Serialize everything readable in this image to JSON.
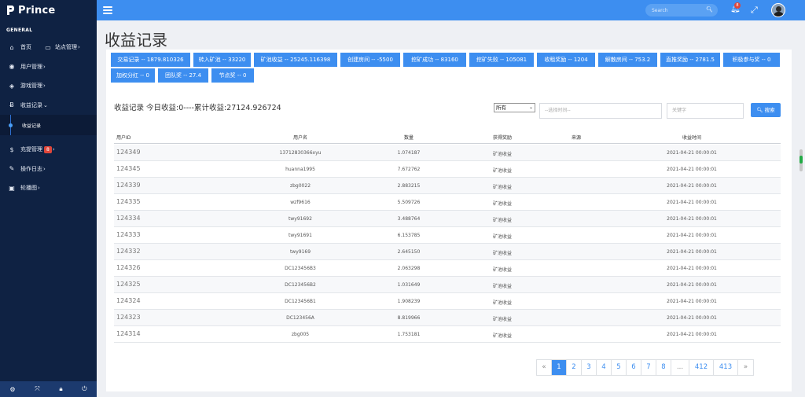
{
  "brand": {
    "name": "Prince"
  },
  "sidebar": {
    "section": "GENERAL",
    "items": [
      {
        "icon": "home-icon",
        "label": "首页",
        "extra_icon": "monitor-icon",
        "extra_label": "站点管理",
        "arrow": "›"
      },
      {
        "icon": "user-circle-icon",
        "label": "用户管理",
        "arrow": "›"
      },
      {
        "icon": "cube-icon",
        "label": "游戏管理",
        "arrow": "›"
      },
      {
        "icon": "bitcoin-icon",
        "label": "收益记录",
        "arrow": "⌄"
      },
      {
        "icon": "dollar-icon",
        "label": "充提管理",
        "badge": "8",
        "arrow": "›"
      },
      {
        "icon": "edit-icon",
        "label": "操作日志",
        "arrow": "›"
      },
      {
        "icon": "image-icon",
        "label": "轮播图",
        "arrow": "›"
      }
    ],
    "sub_items": [
      {
        "label": "收益记录"
      }
    ],
    "bottom_icons": [
      "gear-icon",
      "expand-icon",
      "lock-icon",
      "power-icon"
    ]
  },
  "topbar": {
    "search_placeholder": "Search",
    "notification_count": "8"
  },
  "page": {
    "title": "收益记录"
  },
  "stats": [
    "交易记录 -- 1879.810326",
    "转入矿池 -- 33220",
    "矿池收益 -- 25245.116398",
    "创建房间 -- -5500",
    "挖矿成功 -- 83160",
    "挖矿失败 -- 105081",
    "收租奖励 -- 1204",
    "解散房间 -- 753.2",
    "直推奖励 -- 2781.5",
    "积极参与奖 -- 0",
    "加权分红 -- 0",
    "团队奖 -- 27.4",
    "节点奖 -- 0"
  ],
  "summary": "收益记录 今日收益:0----累计收益:27124.926724",
  "filters": {
    "select_value": "所有",
    "date_placeholder": "--选择时间--",
    "keyword_placeholder": "关键字",
    "search_label": "搜索"
  },
  "table": {
    "headers": [
      "用户ID",
      "用户名",
      "数量",
      "获得奖励",
      "来源",
      "收益时间"
    ],
    "rows": [
      [
        "124349",
        "13712830366xyu",
        "1.074187",
        "矿池收益",
        "",
        "2021-04-21 00:00:01"
      ],
      [
        "124345",
        "huanna1995",
        "7.672762",
        "矿池收益",
        "",
        "2021-04-21 00:00:01"
      ],
      [
        "124339",
        "zbg0022",
        "2.883215",
        "矿池收益",
        "",
        "2021-04-21 00:00:01"
      ],
      [
        "124335",
        "wzf9616",
        "5.509726",
        "矿池收益",
        "",
        "2021-04-21 00:00:01"
      ],
      [
        "124334",
        "twy91692",
        "3.488764",
        "矿池收益",
        "",
        "2021-04-21 00:00:01"
      ],
      [
        "124333",
        "twy91691",
        "6.153785",
        "矿池收益",
        "",
        "2021-04-21 00:00:01"
      ],
      [
        "124332",
        "twy9169",
        "2.645150",
        "矿池收益",
        "",
        "2021-04-21 00:00:01"
      ],
      [
        "124326",
        "DC123456B3",
        "2.063298",
        "矿池收益",
        "",
        "2021-04-21 00:00:01"
      ],
      [
        "124325",
        "DC123456B2",
        "1.031649",
        "矿池收益",
        "",
        "2021-04-21 00:00:01"
      ],
      [
        "124324",
        "DC123456B1",
        "1.908239",
        "矿池收益",
        "",
        "2021-04-21 00:00:01"
      ],
      [
        "124323",
        "DC123456A",
        "8.819966",
        "矿池收益",
        "",
        "2021-04-21 00:00:01"
      ],
      [
        "124314",
        "zbg005",
        "1.753181",
        "矿池收益",
        "",
        "2021-04-21 00:00:01"
      ]
    ]
  },
  "pagination": [
    "«",
    "1",
    "2",
    "3",
    "4",
    "5",
    "6",
    "7",
    "8",
    "...",
    "412",
    "413",
    "»"
  ],
  "pagination_active": "1",
  "colors": {
    "sidebar": "#0f2243",
    "accent": "#3d8ef0",
    "badge": "#e0463a"
  }
}
